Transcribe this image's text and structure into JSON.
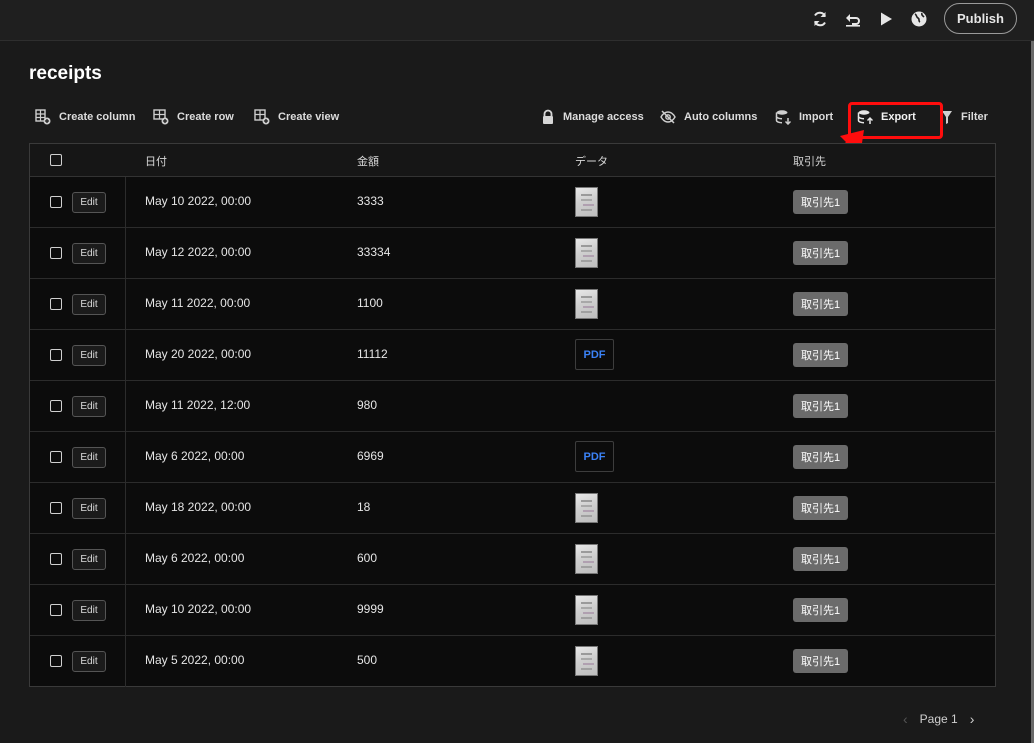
{
  "topbar": {
    "publish_label": "Publish"
  },
  "page": {
    "title": "receipts"
  },
  "toolbar": {
    "create_column": "Create column",
    "create_row": "Create row",
    "create_view": "Create view",
    "manage_access": "Manage access",
    "auto_columns": "Auto columns",
    "import": "Import",
    "export": "Export",
    "filter": "Filter"
  },
  "table": {
    "headers": [
      "日付",
      "金額",
      "データ",
      "取引先"
    ],
    "edit_label": "Edit",
    "rows": [
      {
        "date": "May 10 2022, 00:00",
        "amount": "3333",
        "data": "image",
        "vendor": "取引先1"
      },
      {
        "date": "May 12 2022, 00:00",
        "amount": "33334",
        "data": "image",
        "vendor": "取引先1"
      },
      {
        "date": "May 11 2022, 00:00",
        "amount": "1100",
        "data": "image",
        "vendor": "取引先1"
      },
      {
        "date": "May 20 2022, 00:00",
        "amount": "11112",
        "data": "pdf",
        "pdf_label": "PDF",
        "vendor": "取引先1"
      },
      {
        "date": "May 11 2022, 12:00",
        "amount": "980",
        "data": "none",
        "vendor": "取引先1"
      },
      {
        "date": "May 6 2022, 00:00",
        "amount": "6969",
        "data": "pdf",
        "pdf_label": "PDF",
        "vendor": "取引先1"
      },
      {
        "date": "May 18 2022, 00:00",
        "amount": "18",
        "data": "image",
        "vendor": "取引先1"
      },
      {
        "date": "May 6 2022, 00:00",
        "amount": "600",
        "data": "image",
        "vendor": "取引先1"
      },
      {
        "date": "May 10 2022, 00:00",
        "amount": "9999",
        "data": "image",
        "vendor": "取引先1"
      },
      {
        "date": "May 5 2022, 00:00",
        "amount": "500",
        "data": "image",
        "vendor": "取引先1"
      }
    ]
  },
  "pagination": {
    "label": "Page 1"
  },
  "colors": {
    "background": "#1a1a1a",
    "table_bg": "#0c0c0c",
    "tag_bg": "#6b6b6b",
    "pdf_text": "#3b82f6",
    "annotation": "#ff0d0d"
  }
}
